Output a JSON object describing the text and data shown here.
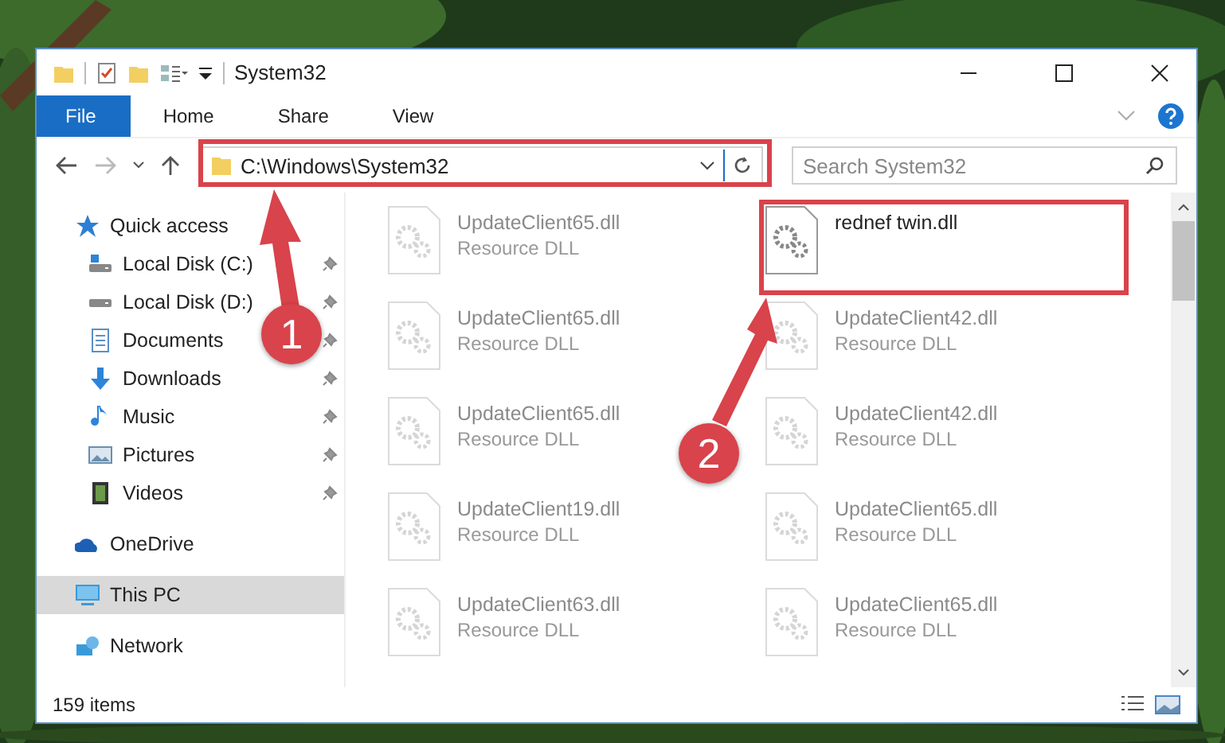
{
  "window": {
    "title": "System32"
  },
  "ribbon_tabs": [
    {
      "label": "File",
      "selected": true
    },
    {
      "label": "Home",
      "selected": false
    },
    {
      "label": "Share",
      "selected": false
    },
    {
      "label": "View",
      "selected": false
    }
  ],
  "address": {
    "value": "C:\\Windows\\System32"
  },
  "search": {
    "placeholder": "Search System32"
  },
  "sidebar": {
    "items": [
      {
        "label": "Quick access",
        "selected": false,
        "children": [
          {
            "label": "Local Disk (C:)",
            "pinned": true,
            "selected": false
          },
          {
            "label": "Local Disk (D:)",
            "pinned": true,
            "selected": false
          },
          {
            "label": "Documents",
            "pinned": true,
            "selected": false
          },
          {
            "label": "Downloads",
            "pinned": true,
            "selected": false
          },
          {
            "label": "Music",
            "pinned": true,
            "selected": false
          },
          {
            "label": "Pictures",
            "pinned": true,
            "selected": false
          },
          {
            "label": "Videos",
            "pinned": true,
            "selected": false
          }
        ]
      },
      {
        "label": "OneDrive",
        "selected": false
      },
      {
        "label": "This PC",
        "selected": true
      },
      {
        "label": "Network",
        "selected": false
      }
    ]
  },
  "files": [
    {
      "name": "UpdateClient65.dll",
      "type": "Resource DLL",
      "faded": true
    },
    {
      "name": "rednef twin.dll",
      "faded": false
    },
    {
      "name": "UpdateClient65.dll",
      "type": "Resource DLL",
      "faded": true
    },
    {
      "name": "UpdateClient42.dll",
      "type": "Resource DLL",
      "faded": true
    },
    {
      "name": "UpdateClient65.dll",
      "type": "Resource DLL",
      "faded": true
    },
    {
      "name": "UpdateClient42.dll",
      "type": "Resource DLL",
      "faded": true
    },
    {
      "name": "UpdateClient19.dll",
      "type": "Resource DLL",
      "faded": true
    },
    {
      "name": "UpdateClient65.dll",
      "type": "Resource DLL",
      "faded": true
    },
    {
      "name": "UpdateClient63.dll",
      "type": "Resource DLL",
      "faded": true
    },
    {
      "name": "UpdateClient65.dll",
      "type": "Resource DLL",
      "faded": true
    }
  ],
  "status_bar": {
    "count": "159 items"
  },
  "annotations": [
    {
      "label": "1"
    },
    {
      "label": "2"
    }
  ]
}
